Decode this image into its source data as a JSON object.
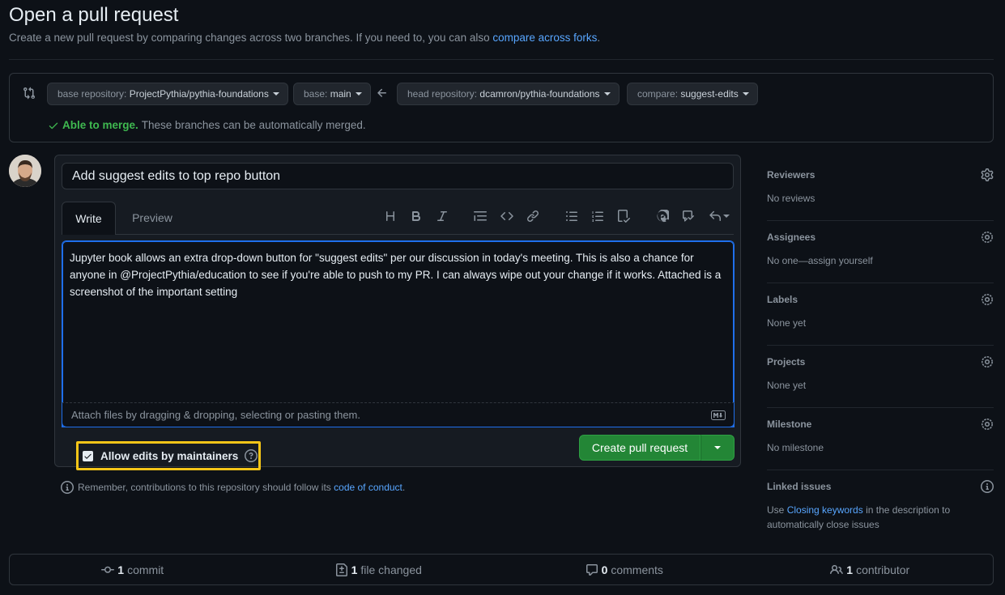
{
  "header": {
    "title": "Open a pull request",
    "subtitle": "Create a new pull request by comparing changes across two branches. If you need to, you can also",
    "subtitle_link": "compare across forks",
    "subtitle_end": "."
  },
  "range": {
    "base_repo_label": "base repository:",
    "base_repo_value": "ProjectPythia/pythia-foundations",
    "base_label": "base:",
    "base_value": "main",
    "head_repo_label": "head repository:",
    "head_repo_value": "dcamron/pythia-foundations",
    "compare_label": "compare:",
    "compare_value": "suggest-edits",
    "merge_status": "Able to merge.",
    "merge_message": "These branches can be automatically merged."
  },
  "composer": {
    "title_value": "Add suggest edits to top repo button",
    "tab_write": "Write",
    "tab_preview": "Preview",
    "body_text": "Jupyter book allows an extra drop-down button for \"suggest edits\" per our discussion in today's meeting. This is also a chance for anyone in @ProjectPythia/education to see if you're able to push to my PR. I can always wipe out your change if it works. Attached is a screenshot of the important setting ",
    "attach_hint": "Attach files by dragging & dropping, selecting or pasting them.",
    "allow_edits_label": "Allow edits by maintainers",
    "create_button": "Create pull request"
  },
  "remember": {
    "text": "Remember, contributions to this repository should follow its",
    "link": "code of conduct",
    "end": "."
  },
  "sidebar": {
    "reviewers_title": "Reviewers",
    "reviewers_value": "No reviews",
    "assignees_title": "Assignees",
    "assignees_value": "No one—assign yourself",
    "labels_title": "Labels",
    "labels_value": "None yet",
    "projects_title": "Projects",
    "projects_value": "None yet",
    "milestone_title": "Milestone",
    "milestone_value": "No milestone",
    "linked_title": "Linked issues",
    "linked_pre": "Use",
    "linked_link": "Closing keywords",
    "linked_post": "in the description to automatically close issues"
  },
  "stats": {
    "commits_count": "1",
    "commits_label": "commit",
    "files_count": "1",
    "files_label": "file changed",
    "comments_count": "0",
    "comments_label": "comments",
    "contributors_count": "1",
    "contributors_label": "contributor"
  },
  "colors": {
    "background": "#0d1117",
    "accent_blue": "#58a6ff",
    "success_green": "#238636",
    "highlight_yellow": "#f5c518"
  }
}
